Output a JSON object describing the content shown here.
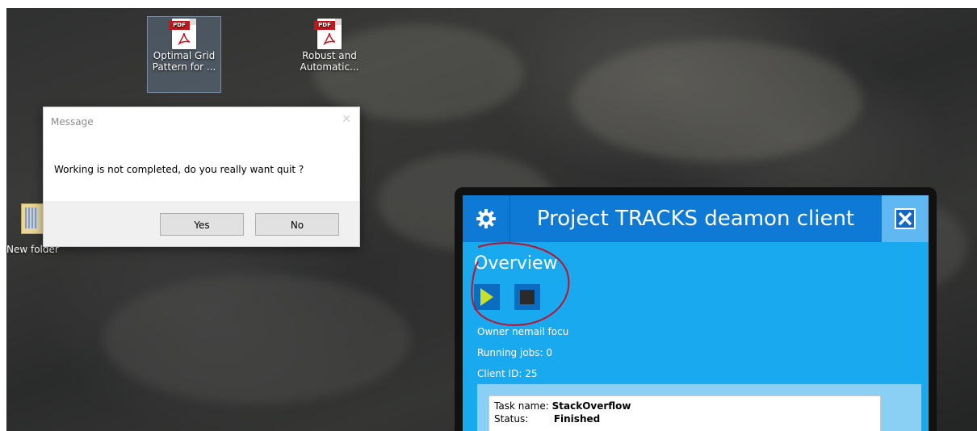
{
  "desktop": {
    "icons": [
      {
        "label_line1": "Optimal Grid",
        "label_line2": "Pattern for ...",
        "tag": "PDF"
      },
      {
        "label_line1": "Robust and",
        "label_line2": "Automatic...",
        "tag": "PDF"
      }
    ],
    "folder": {
      "label": "New folder"
    }
  },
  "dialog": {
    "title": "Message",
    "message": "Working is not completed, do you really want quit ?",
    "yes_label": "Yes",
    "no_label": "No"
  },
  "tracks": {
    "title": "Project TRACKS deamon client",
    "section": "Overview",
    "owner": "Owner nemail focu",
    "running_jobs": "Running jobs: 0",
    "client_id": "Client ID: 25",
    "task": {
      "name_label": "Task name:",
      "name_value": "StackOverflow",
      "status_label": "Status:",
      "status_value": "Finished"
    },
    "colors": {
      "header": "#0f7ad6",
      "body": "#19a9ef",
      "close": "#5fb8f2",
      "play": "#cbe02a"
    }
  },
  "icons": [
    "pdf-icon",
    "folder-icon",
    "gear-icon",
    "close-icon",
    "play-icon",
    "stop-icon"
  ]
}
